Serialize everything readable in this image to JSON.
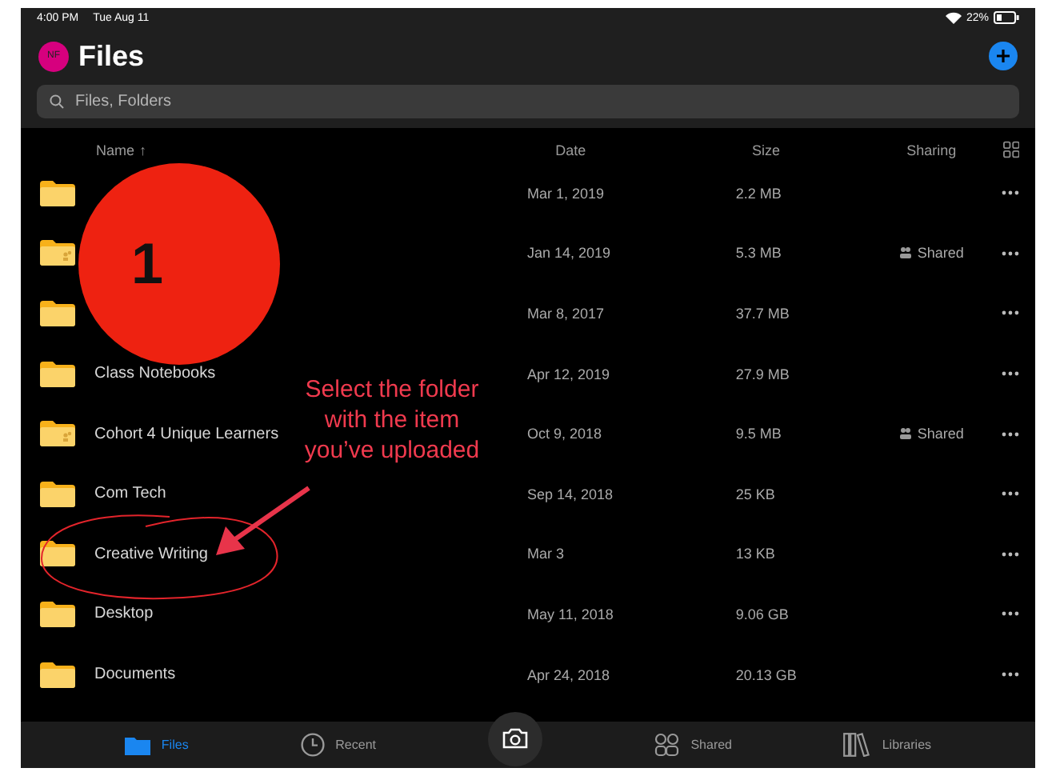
{
  "status_bar": {
    "time": "4:00 PM",
    "date": "Tue Aug 11",
    "battery": "22%"
  },
  "header": {
    "avatar": "NF",
    "title": "Files"
  },
  "search": {
    "placeholder": "Files, Folders"
  },
  "columns": {
    "name": "Name",
    "sort": "↑",
    "date": "Date",
    "size": "Size",
    "sharing": "Sharing"
  },
  "rows": [
    {
      "date": "Mar 1, 2019",
      "size": "2.2 MB",
      "shared": false
    },
    {
      "date": "Jan 14, 2019",
      "size": "5.3 MB",
      "sharing": "Shared",
      "shared": true
    },
    {
      "date": "Mar 8, 2017",
      "size": "37.7 MB",
      "shared": false
    },
    {
      "name": "Class Notebooks",
      "date": "Apr 12, 2019",
      "size": "27.9 MB",
      "shared": false
    },
    {
      "name": "Cohort 4 Unique Learners",
      "date": "Oct 9, 2018",
      "size": "9.5 MB",
      "sharing": "Shared",
      "shared": true
    },
    {
      "name": "Com Tech",
      "date": "Sep 14, 2018",
      "size": "25 KB",
      "shared": false
    },
    {
      "name": "Creative Writing",
      "date": "Mar 3",
      "size": "13 KB",
      "shared": false
    },
    {
      "name": "Desktop",
      "date": "May 11, 2018",
      "size": "9.06 GB",
      "shared": false
    },
    {
      "name": "Documents",
      "date": "Apr 24, 2018",
      "size": "20.13 GB",
      "shared": false
    }
  ],
  "tabs": [
    {
      "label": "Files",
      "kind": "folder",
      "selected": true
    },
    {
      "label": "Recent",
      "kind": "clock",
      "selected": false
    },
    {
      "kind": "camera",
      "selected": false
    },
    {
      "label": "Shared",
      "kind": "people",
      "selected": false
    },
    {
      "label": "Libraries",
      "kind": "books",
      "selected": false
    }
  ],
  "annotation": {
    "step": "1",
    "note": "Select the folder with the item you’ve uploaded"
  }
}
